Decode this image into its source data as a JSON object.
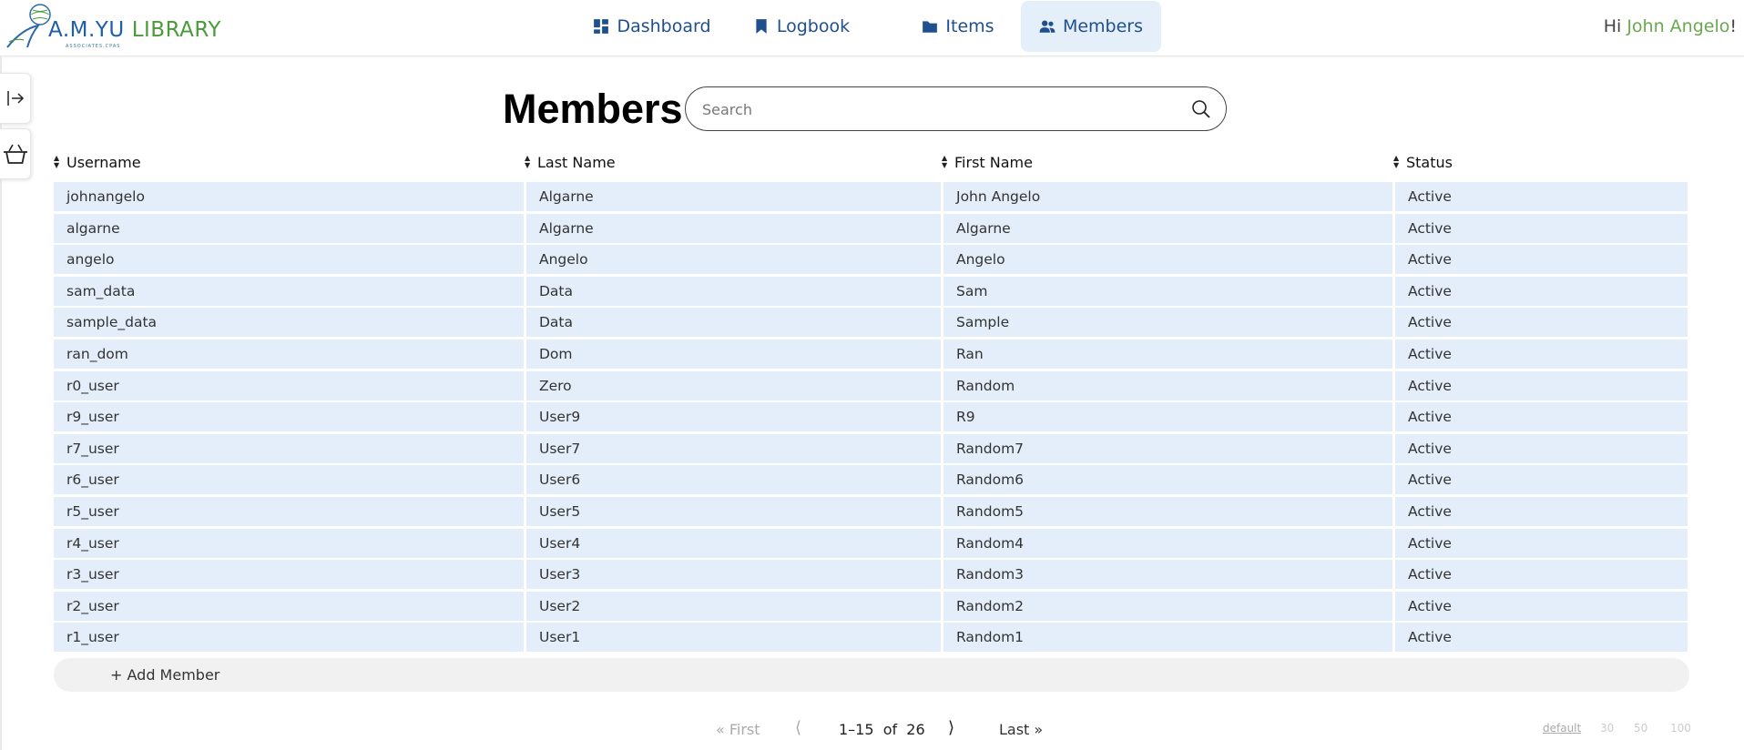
{
  "header": {
    "logo": {
      "brand": "A.M.YU",
      "library": "LIBRARY",
      "subtitle": "ASSOCIATES,CPAS"
    },
    "nav": [
      {
        "label": "Dashboard",
        "icon": "dashboard-icon",
        "active": false
      },
      {
        "label": "Logbook",
        "icon": "bookmark-icon",
        "active": false
      },
      {
        "label": "Items",
        "icon": "folder-icon",
        "active": false
      },
      {
        "label": "Members",
        "icon": "users-icon",
        "active": true
      }
    ],
    "greeting": {
      "prefix": "Hi ",
      "name": "John Angelo",
      "suffix": "!"
    }
  },
  "sidebar": {
    "buttons": [
      {
        "icon": "expand-sidebar-icon"
      },
      {
        "icon": "basket-icon"
      }
    ]
  },
  "main": {
    "title": "Members",
    "search": {
      "placeholder": "Search",
      "value": ""
    }
  },
  "table": {
    "columns": [
      "Username",
      "Last Name",
      "First Name",
      "Status"
    ],
    "rows": [
      [
        "johnangelo",
        "Algarne",
        "John Angelo",
        "Active"
      ],
      [
        "algarne",
        "Algarne",
        "Algarne",
        "Active"
      ],
      [
        "angelo",
        "Angelo",
        "Angelo",
        "Active"
      ],
      [
        "sam_data",
        "Data",
        "Sam",
        "Active"
      ],
      [
        "sample_data",
        "Data",
        "Sample",
        "Active"
      ],
      [
        "ran_dom",
        "Dom",
        "Ran",
        "Active"
      ],
      [
        "r0_user",
        "Zero",
        "Random",
        "Active"
      ],
      [
        "r9_user",
        "User9",
        "R9",
        "Active"
      ],
      [
        "r7_user",
        "User7",
        "Random7",
        "Active"
      ],
      [
        "r6_user",
        "User6",
        "Random6",
        "Active"
      ],
      [
        "r5_user",
        "User5",
        "Random5",
        "Active"
      ],
      [
        "r4_user",
        "User4",
        "Random4",
        "Active"
      ],
      [
        "r3_user",
        "User3",
        "Random3",
        "Active"
      ],
      [
        "r2_user",
        "User2",
        "Random2",
        "Active"
      ],
      [
        "r1_user",
        "User1",
        "Random1",
        "Active"
      ]
    ],
    "add_label": "+ Add Member"
  },
  "pagination": {
    "first": "« First",
    "prev": "⟨",
    "range": "1–15  of  26",
    "next": "⟩",
    "last": "Last »",
    "page_sizes": [
      "default",
      "30",
      "50",
      "100"
    ]
  },
  "colors": {
    "accent": "#1f4f8f",
    "row_bg": "#e4eefa",
    "active_nav_bg": "#e5eff9",
    "name_green": "#6aa84f"
  }
}
